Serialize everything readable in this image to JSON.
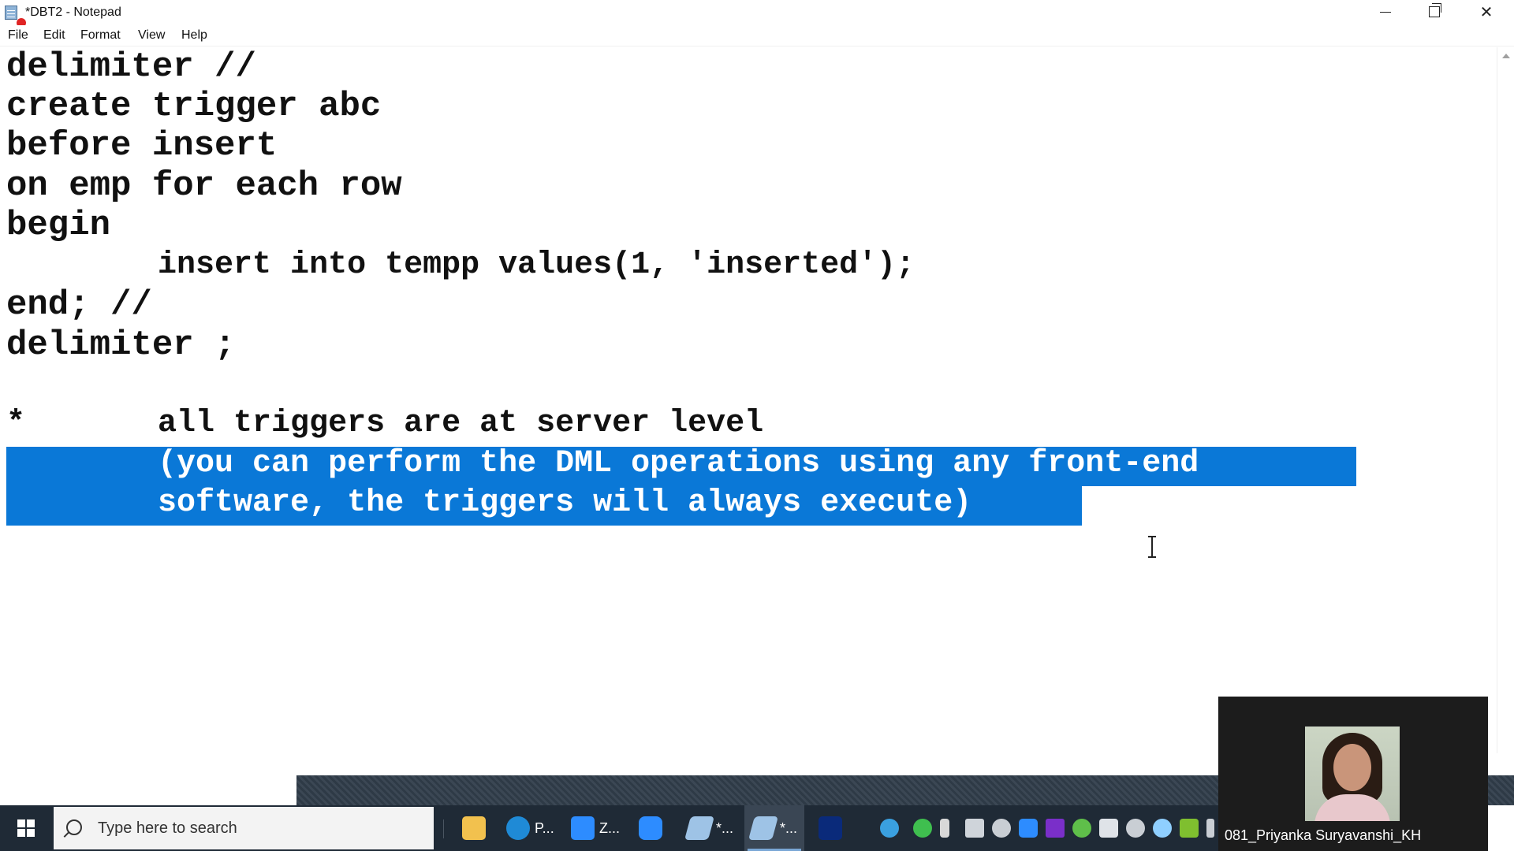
{
  "window": {
    "title": "*DBT2 - Notepad"
  },
  "menu": [
    "File",
    "Edit",
    "Format",
    "View",
    "Help"
  ],
  "editor": {
    "lines": [
      "delimiter //",
      "create trigger abc",
      "before insert",
      "on emp for each row",
      "begin",
      "        insert into tempp values(1, 'inserted');",
      "end; //",
      "delimiter ;",
      "",
      "*       all triggers are at server level"
    ],
    "selected_lines": [
      "        (you can perform the DML operations using any front-end",
      "        software, the triggers will always execute)"
    ]
  },
  "taskbar": {
    "search_placeholder": "Type here to search",
    "apps": [
      {
        "icon": "file-explorer-icon",
        "label": ""
      },
      {
        "icon": "edge-icon",
        "label": "P..."
      },
      {
        "icon": "zoom-icon",
        "label": "Z..."
      },
      {
        "icon": "zoom-meeting-icon",
        "label": ""
      },
      {
        "icon": "notepad-icon",
        "label": "*..."
      },
      {
        "icon": "notepad-icon",
        "label": "*..."
      },
      {
        "icon": "chart-app-icon",
        "label": ""
      }
    ]
  },
  "video": {
    "participant_name": "081_Priyanka Suryavanshi_KH"
  },
  "colors": {
    "selection": "#0a78d7",
    "taskbar": "#1f2a36"
  }
}
